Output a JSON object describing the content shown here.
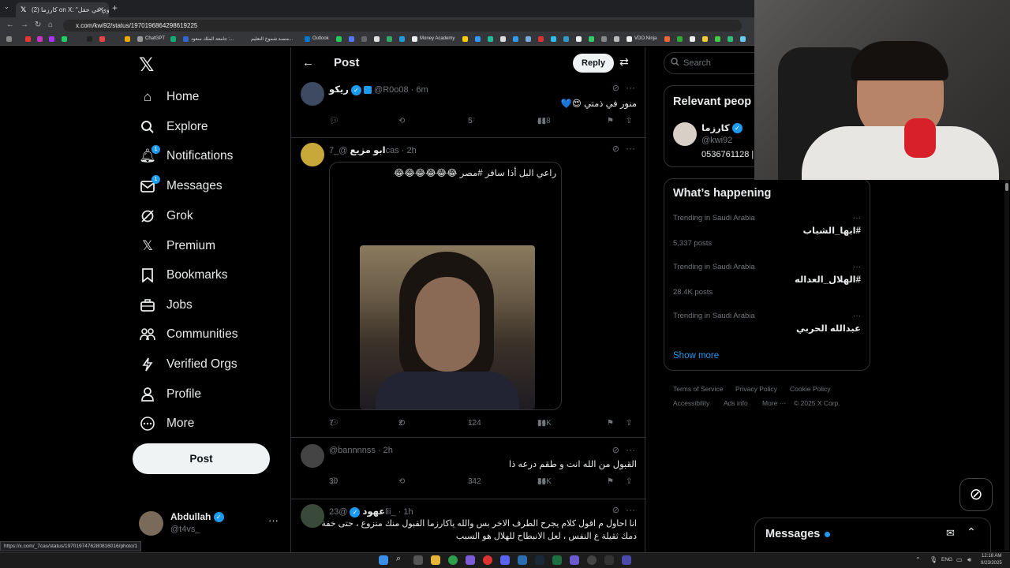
{
  "browser": {
    "tab_title": "(2) كارزما on X: \"البدوي في حفل...",
    "url": "x.com/kwi92/status/1970196864298619225",
    "bookmarks": [
      "ChatGPT",
      "جامعة الملك سعود :...",
      "منصة شموخ التعليم...",
      "Outlook",
      "Money Academy",
      "VDO.Ninja"
    ],
    "status_url": "https://x.com/_7cas/status/1970197476280816016/photo/1"
  },
  "nav": {
    "items": [
      {
        "label": "Home",
        "icon": "home-icon"
      },
      {
        "label": "Explore",
        "icon": "search-icon"
      },
      {
        "label": "Notifications",
        "icon": "bell-icon",
        "badge": "1"
      },
      {
        "label": "Messages",
        "icon": "envelope-icon",
        "badge": "1"
      },
      {
        "label": "Grok",
        "icon": "grok-icon"
      },
      {
        "label": "Premium",
        "icon": "x-logo-icon"
      },
      {
        "label": "Bookmarks",
        "icon": "bookmark-icon"
      },
      {
        "label": "Jobs",
        "icon": "briefcase-icon"
      },
      {
        "label": "Communities",
        "icon": "people-icon"
      },
      {
        "label": "Verified Orgs",
        "icon": "lightning-icon"
      },
      {
        "label": "Profile",
        "icon": "person-icon"
      },
      {
        "label": "More",
        "icon": "more-circle-icon"
      }
    ],
    "post_label": "Post",
    "account": {
      "name": "Abdullah",
      "handle": "@t4vs_"
    }
  },
  "header": {
    "title": "Post",
    "reply_label": "Reply"
  },
  "tweets": [
    {
      "name": "ريكو",
      "handle": "@R0o08",
      "time": "6m",
      "text": "منور في ذمتي 😍💙",
      "replies": "",
      "reposts": "",
      "likes": "5",
      "views": "418"
    },
    {
      "name": "ابو مزيع",
      "handle": "@_7cas",
      "time": "2h",
      "text": "راعي البل أذا سافر #مصر 😂😂😂😂😂😂",
      "replies": "7",
      "reposts": "2",
      "likes": "124",
      "views": "36K"
    },
    {
      "name": "",
      "handle": "@bannnnss",
      "time": "2h",
      "text": "القبول من الله انت و طقم درعه ذا",
      "replies": "30",
      "reposts": "",
      "likes": "342",
      "views": "36K"
    },
    {
      "name": "عهود",
      "handle": "@23lii_",
      "time": "1h",
      "text_line1": "انا احاول م اقول كلام يجرح الطرف الاخر بس والله ياكارزما القبول منك منزوع ، حتى خفة",
      "text_line2": "دمك ثقيلة ع النفس ، لعل الانبطاح للهلال هو السبب"
    }
  ],
  "right": {
    "search_placeholder": "Search",
    "relevant_title": "Relevant peop",
    "relevant_person": {
      "name": "كارزما",
      "handle": "@kwi92",
      "bio": "0536761128 |"
    },
    "happening_title": "What’s happening",
    "trends": [
      {
        "meta": "Trending in Saudi Arabia",
        "name": "#ابها_الشباب",
        "posts": "5,337 posts"
      },
      {
        "meta": "Trending in Saudi Arabia",
        "name": "#الهلال_العداله",
        "posts": "28.4K posts"
      },
      {
        "meta": "Trending in Saudi Arabia",
        "name": "عبدالله الحربي",
        "posts": ""
      }
    ],
    "show_more": "Show more",
    "footer": [
      "Terms of Service",
      "Privacy Policy",
      "Cookie Policy",
      "Accessibility",
      "Ads info",
      "More ···",
      "© 2025 X Corp."
    ]
  },
  "messages_drawer": {
    "title": "Messages"
  },
  "taskbar": {
    "lang": "ENG",
    "time": "12:18 AM",
    "date": "9/23/2025"
  },
  "colors": {
    "accent": "#1d9bf0",
    "bg": "#000000",
    "text": "#e7e9ea",
    "muted": "#71767b",
    "border": "#2f3336"
  }
}
